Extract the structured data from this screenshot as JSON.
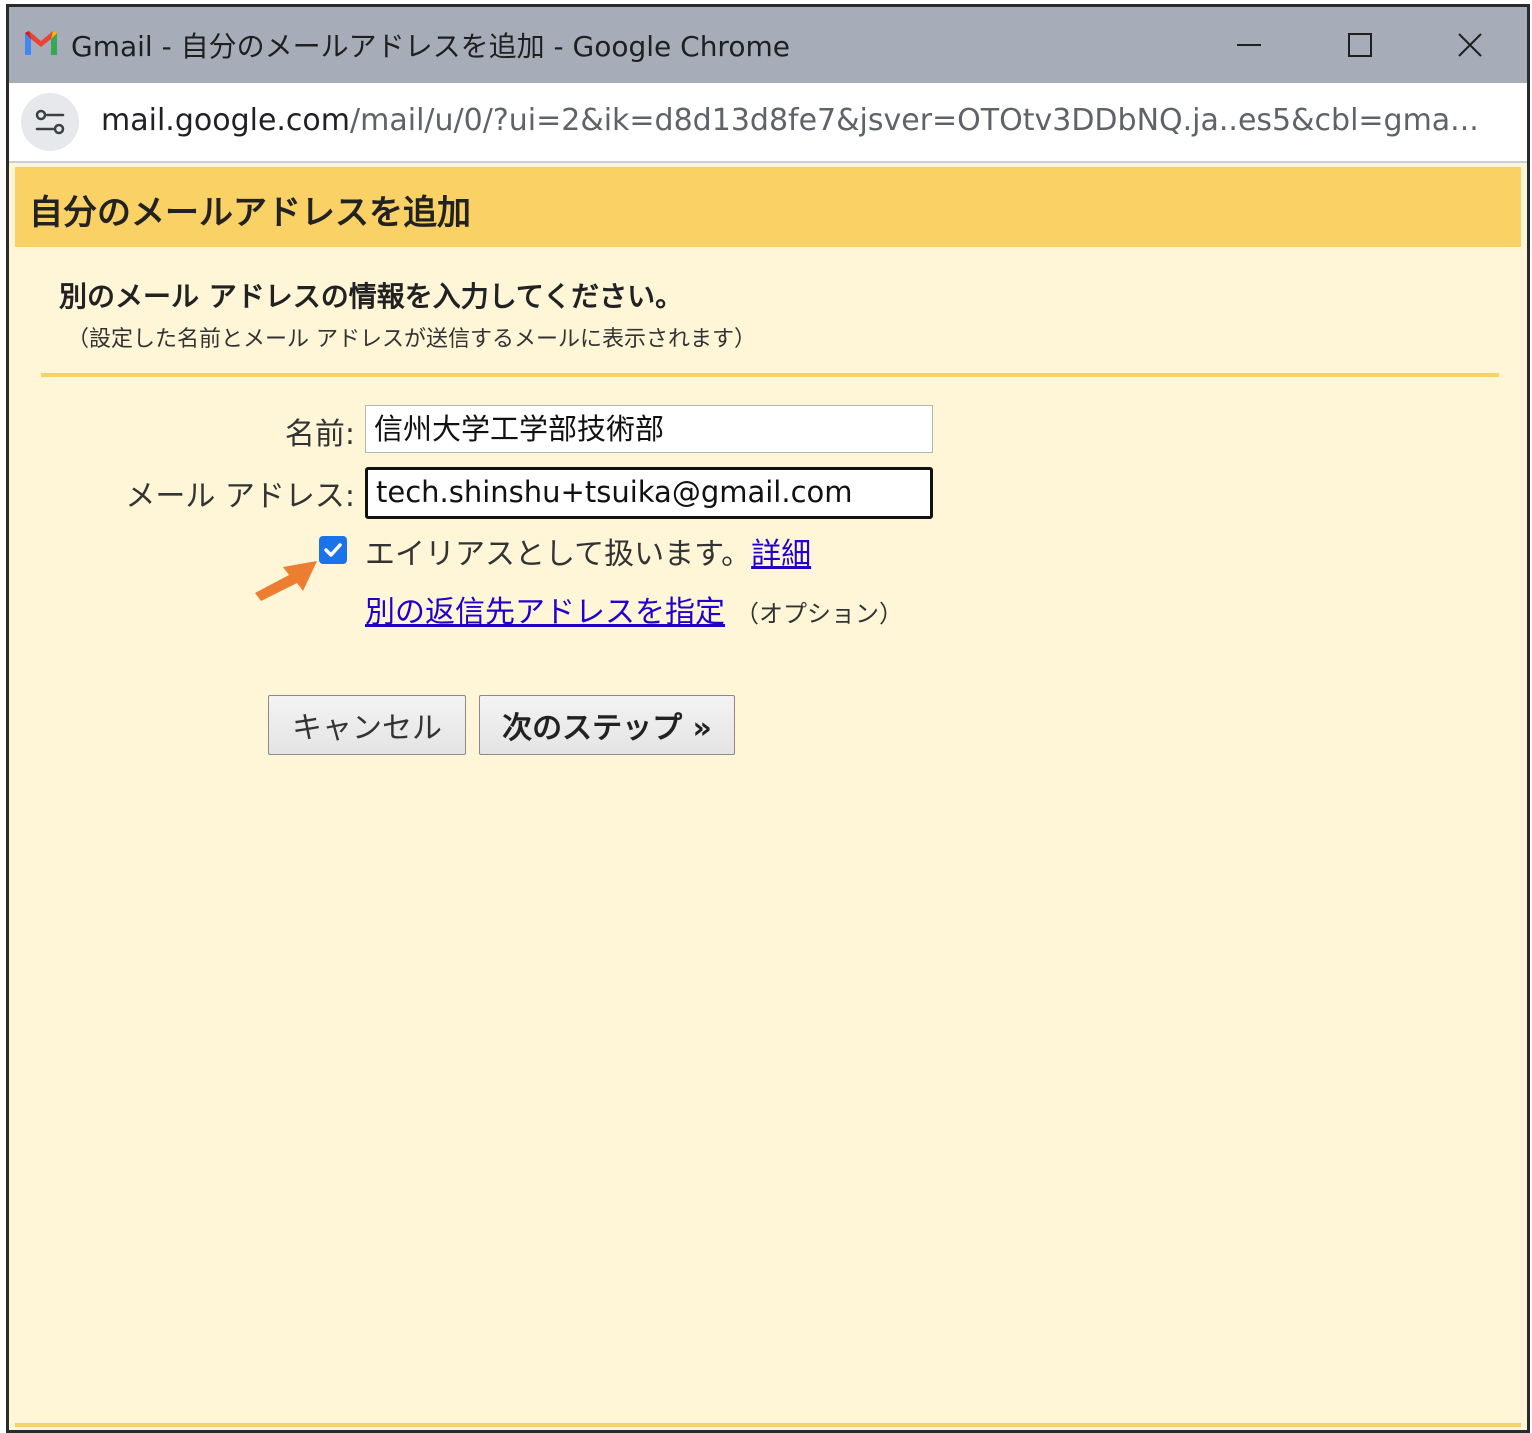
{
  "window": {
    "title": "Gmail - 自分のメールアドレスを追加 - Google Chrome",
    "icons": {
      "app": "gmail-logo-icon",
      "minimize": "minimize-icon",
      "maximize": "maximize-icon",
      "close": "close-icon",
      "site_info": "site-settings-icon"
    }
  },
  "address_bar": {
    "host": "mail.google.com",
    "path": "/mail/u/0/?ui=2&ik=d8d13d8fe7&jsver=OTOtv3DDbNQ.ja..es5&cbl=gma..."
  },
  "dialog": {
    "heading": "自分のメールアドレスを追加",
    "instruction": "別のメール アドレスの情報を入力してください。",
    "note": "（設定した名前とメール アドレスが送信するメールに表示されます）",
    "form": {
      "name_label": "名前:",
      "name_value": "信州大学工学部技術部",
      "email_label": "メール アドレス:",
      "email_value": "tech.shinshu+tsuika@gmail.com",
      "alias_checked": true,
      "alias_label": "エイリアスとして扱います。",
      "alias_details_link": "詳細",
      "reply_to_link": "別の返信先アドレスを指定",
      "reply_to_optional": "（オプション）"
    },
    "buttons": {
      "cancel": "キャンセル",
      "next": "次のステップ »"
    }
  },
  "annotation": {
    "arrow_color": "#ed7d31",
    "arrow_icon": "arrow-pointer-icon"
  },
  "colors": {
    "header_bg": "#fad165",
    "content_bg": "#fff6d8",
    "checkbox_blue": "#1a73e8",
    "link": "#2200cc",
    "titlebar": "#a7adb8"
  }
}
